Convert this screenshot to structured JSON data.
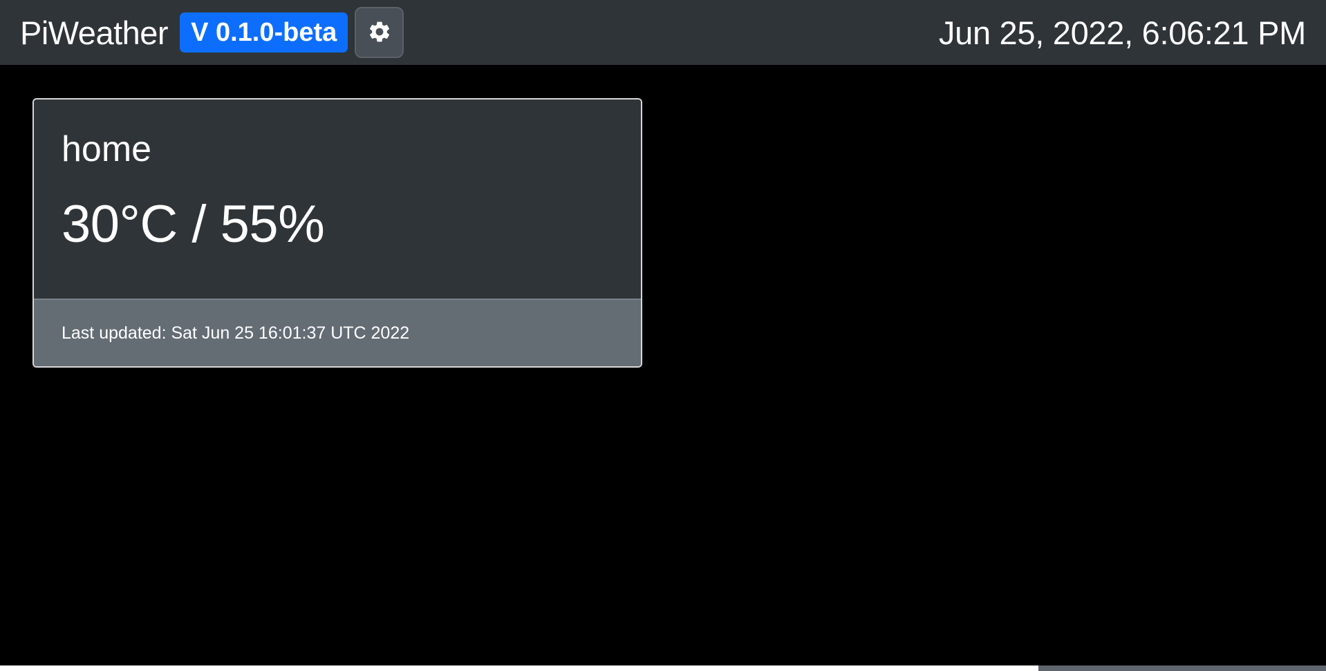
{
  "navbar": {
    "brand": "PiWeather",
    "version": "V 0.1.0-beta",
    "settings_icon": "gear-icon",
    "datetime": "Jun 25, 2022, 6:06:21 PM"
  },
  "sensor_card": {
    "name": "home",
    "reading": "30°C / 55%",
    "last_updated": "Last updated: Sat Jun 25 16:01:37 UTC 2022"
  },
  "colors": {
    "navbar_bg": "#2f3438",
    "badge_blue": "#0d6efd",
    "card_footer": "#646c74",
    "page_bg": "#000000"
  }
}
